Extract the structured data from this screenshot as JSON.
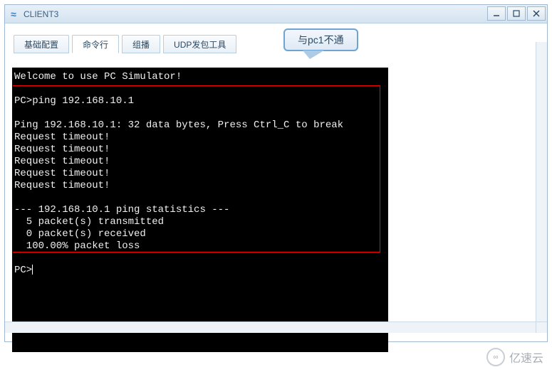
{
  "window": {
    "title": "CLIENT3"
  },
  "tabs": [
    {
      "label": "基础配置",
      "active": false
    },
    {
      "label": "命令行",
      "active": true
    },
    {
      "label": "组播",
      "active": false
    },
    {
      "label": "UDP发包工具",
      "active": false
    }
  ],
  "terminal": {
    "welcome": "Welcome to use PC Simulator!",
    "blank": "",
    "cmd_line": "PC>ping 192.168.10.1",
    "ping_header": "Ping 192.168.10.1: 32 data bytes, Press Ctrl_C to break",
    "timeout": "Request timeout!",
    "stats_sep": "--- 192.168.10.1 ping statistics ---",
    "stats_tx": "  5 packet(s) transmitted",
    "stats_rx": "  0 packet(s) received",
    "stats_loss": "  100.00% packet loss",
    "prompt": "PC>"
  },
  "callout": {
    "text": "与pc1不通"
  },
  "watermark": {
    "text": "亿速云"
  }
}
